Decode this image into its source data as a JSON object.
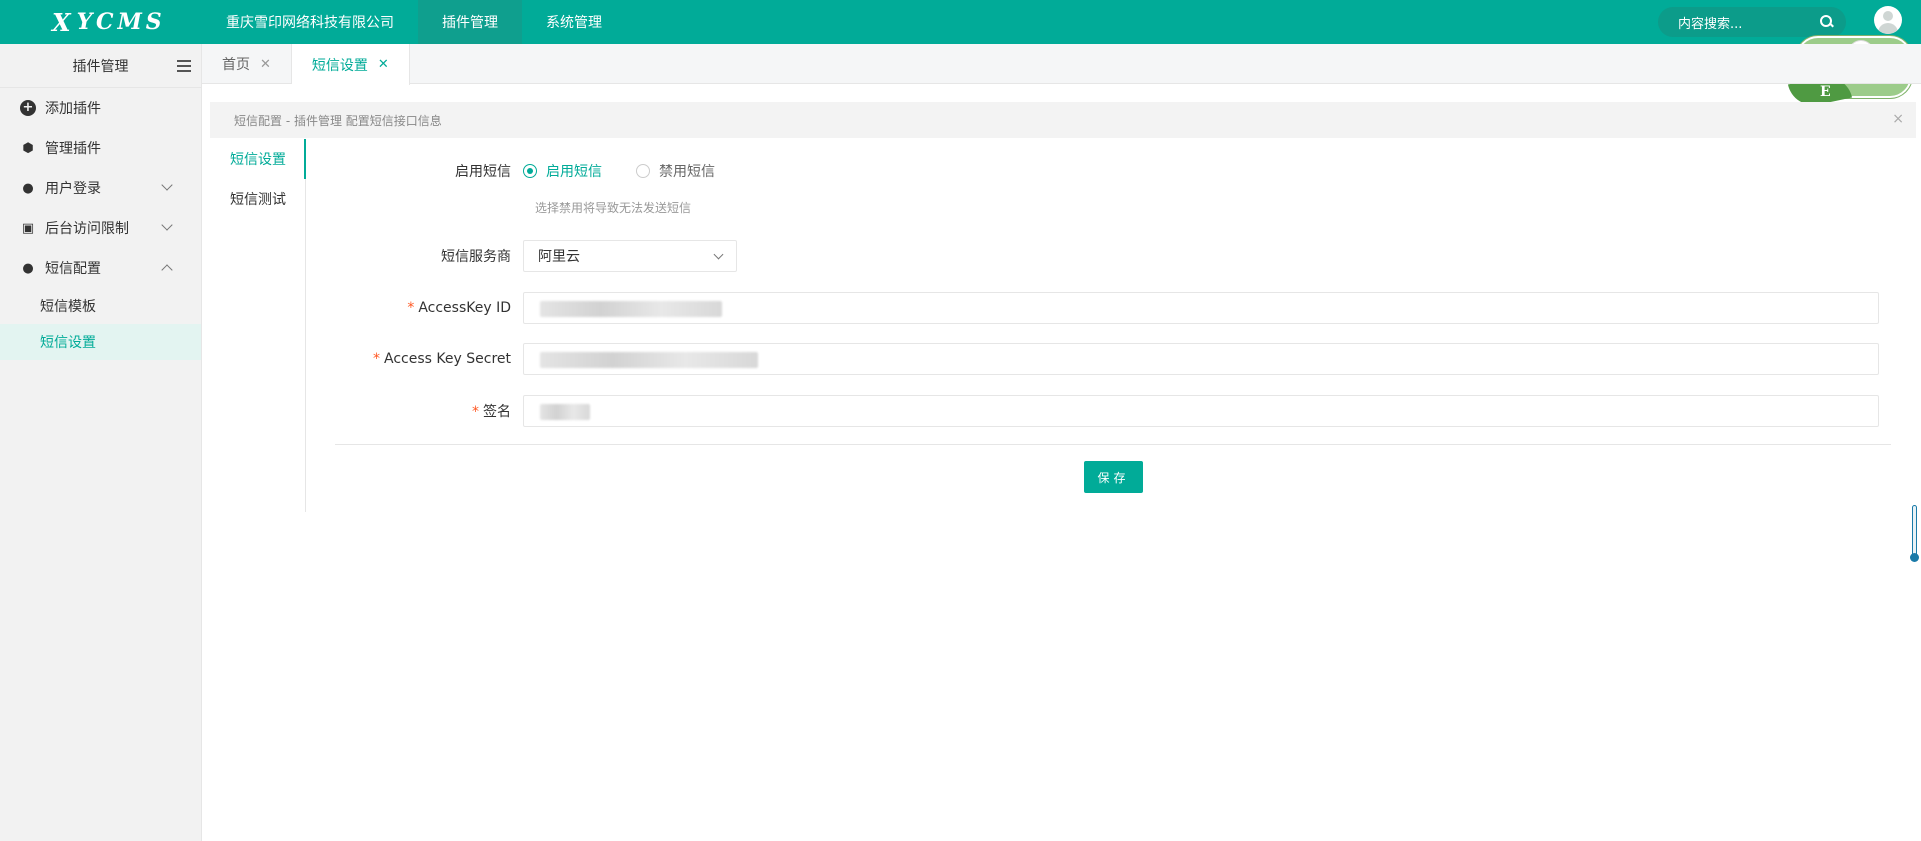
{
  "topbar": {
    "logo": "YCMS",
    "logo_mark": "X",
    "nav": [
      {
        "label": "重庆雪印网络科技有限公司",
        "active": false
      },
      {
        "label": "插件管理",
        "active": true
      },
      {
        "label": "系统管理",
        "active": false
      }
    ],
    "search_placeholder": "内容搜索...",
    "accent": "#01ab98"
  },
  "sidebar": {
    "title": "插件管理",
    "items": [
      {
        "label": "添加插件",
        "icon": "plus-circle-icon"
      },
      {
        "label": "管理插件",
        "icon": "cube-icon"
      },
      {
        "label": "用户登录",
        "icon": "user-icon"
      },
      {
        "label": "后台访问限制",
        "icon": "lock-icon"
      },
      {
        "label": "短信配置",
        "icon": "user-icon"
      }
    ],
    "subitems": [
      {
        "label": "短信模板",
        "active": false
      },
      {
        "label": "短信设置",
        "active": true
      }
    ]
  },
  "tabs": [
    {
      "label": "首页",
      "active": false
    },
    {
      "label": "短信设置",
      "active": true
    }
  ],
  "notice": {
    "text": "短信配置 - 插件管理 配置短信接口信息",
    "close": "×"
  },
  "vtabs": [
    {
      "label": "短信设置",
      "active": true
    },
    {
      "label": "短信测试",
      "active": false
    }
  ],
  "form": {
    "enable": {
      "label": "启用短信",
      "options": [
        {
          "label": "启用短信",
          "checked": true
        },
        {
          "label": "禁用短信",
          "checked": false
        }
      ],
      "hint": "选择禁用将导致无法发送短信"
    },
    "provider": {
      "label": "短信服务商",
      "value": "阿里云"
    },
    "access_key_id": {
      "label": "AccessKey ID",
      "required": "*"
    },
    "access_key_secret": {
      "label": "Access Key Secret",
      "required": "*"
    },
    "signature": {
      "label": "签名",
      "required": "*"
    },
    "save_label": "保存"
  }
}
